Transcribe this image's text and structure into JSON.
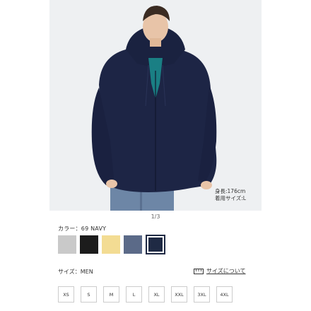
{
  "gallery": {
    "pager": "1/3",
    "model_height": "身長:176cm",
    "model_size": "着用サイズ:L",
    "favorite_icon": "heart-plus-icon"
  },
  "color": {
    "label": "カラー：69 NAVY",
    "swatches": [
      {
        "name": "gray",
        "color": "#c9c9c9",
        "selected": false
      },
      {
        "name": "black",
        "color": "#1c1c1c",
        "selected": false
      },
      {
        "name": "yellow",
        "color": "#f3dc93",
        "selected": false
      },
      {
        "name": "blue",
        "color": "#5b6a88",
        "selected": false
      },
      {
        "name": "navy",
        "color": "#1f2a44",
        "selected": true
      }
    ]
  },
  "size": {
    "label": "サイズ：MEN",
    "guide_label": "サイズについて",
    "guide_icon": "ruler-icon",
    "options": [
      "XS",
      "S",
      "M",
      "L",
      "XL",
      "XXL",
      "3XL",
      "4XL"
    ]
  }
}
